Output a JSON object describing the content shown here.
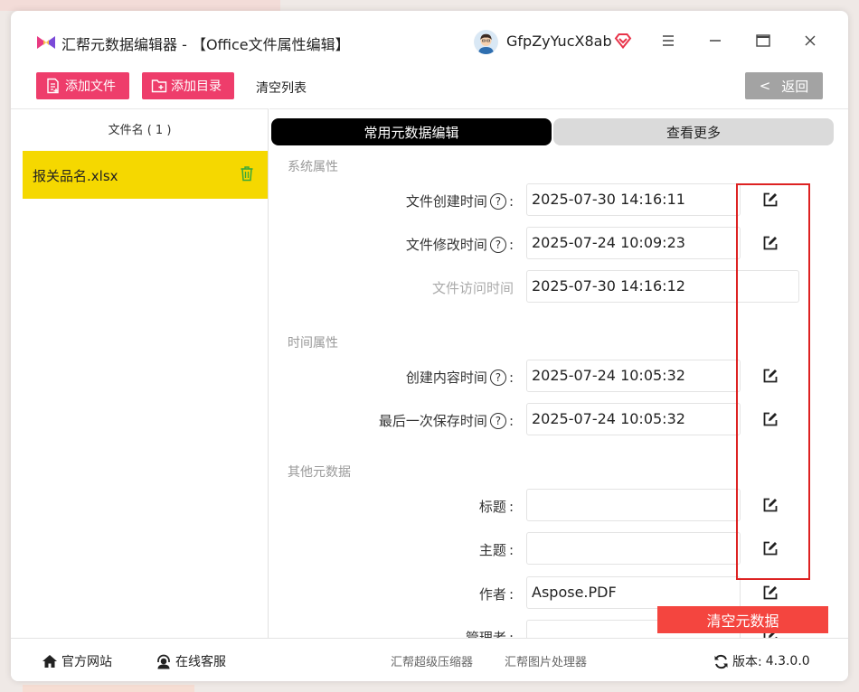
{
  "app": {
    "title": "汇帮元数据编辑器 - 【Office文件属性编辑】",
    "username": "GfpZyYucX8ab",
    "accent_color": "#ee3d6b"
  },
  "toolbar": {
    "add_file_label": "添加文件",
    "add_dir_label": "添加目录",
    "clear_list_label": "清空列表",
    "back_label": "返回",
    "back_icon": "<"
  },
  "file_list": {
    "header": "文件名 ( 1 )",
    "items": [
      {
        "name": "报关品名.xlsx",
        "selected": true
      }
    ]
  },
  "tabs": [
    {
      "label": "常用元数据编辑",
      "active": true
    },
    {
      "label": "查看更多",
      "active": false
    }
  ],
  "sections": {
    "system": "系统属性",
    "time": "时间属性",
    "other": "其他元数据"
  },
  "fields": {
    "create_time": {
      "label": "文件创建时间",
      "value": "2025-07-30 14:16:11"
    },
    "modify_time": {
      "label": "文件修改时间",
      "value": "2025-07-24 10:09:23"
    },
    "access_time": {
      "label": "文件访问时间",
      "value": "2025-07-30 14:16:12"
    },
    "content_created": {
      "label": "创建内容时间",
      "value": "2025-07-24 10:05:32"
    },
    "last_saved": {
      "label": "最后一次保存时间",
      "value": "2025-07-24 10:05:32"
    },
    "title": {
      "label": "标题",
      "value": ""
    },
    "subject": {
      "label": "主题",
      "value": ""
    },
    "author": {
      "label": "作者",
      "value": "Aspose.PDF"
    },
    "manager": {
      "label": "管理者",
      "value": ""
    }
  },
  "help_glyph": "?",
  "colon": ":",
  "clear_metadata_label": "清空元数据",
  "footer": {
    "website": "官方网站",
    "support": "在线客服",
    "compressor": "汇帮超级压缩器",
    "image_tool": "汇帮图片处理器",
    "version_label": "版本:",
    "version": "4.3.0.0"
  }
}
